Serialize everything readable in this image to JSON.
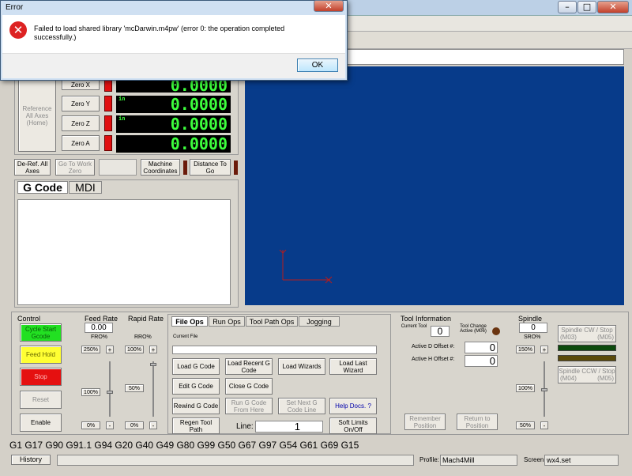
{
  "window": {
    "controls": [
      "–",
      "□",
      "✕"
    ]
  },
  "dro": {
    "ref_all": "Reference All Axes (Home)",
    "axes": [
      {
        "zero": "Zero X",
        "value": "0.0000"
      },
      {
        "zero": "Zero Y",
        "value": "0.0000",
        "unit": "in"
      },
      {
        "zero": "Zero Z",
        "value": "0.0000",
        "unit": "in"
      },
      {
        "zero": "Zero A",
        "value": "0.0000"
      }
    ],
    "deref": "De-Ref. All Axes",
    "goto_zero": "Go To Work Zero",
    "machine_coords": "Machine Coordinates",
    "dist_to_go": "Distance To Go"
  },
  "gcode_tabs": [
    "G Code",
    "MDI"
  ],
  "control": {
    "title": "Control",
    "cycle_start": "Cycle Start Gcode",
    "feed_hold": "Feed Hold",
    "stop": "Stop",
    "reset": "Reset",
    "enable": "Enable"
  },
  "feed": {
    "title": "Feed Rate",
    "value": "0.00",
    "label": "FRO%",
    "max": "250%",
    "mid": "100%",
    "min": "0%",
    "plus": "+",
    "minus": "-"
  },
  "rapid": {
    "title": "Rapid Rate",
    "label": "RRO%",
    "max": "100%",
    "mid": "50%",
    "min": "0%",
    "plus": "+",
    "minus": "-"
  },
  "fileops": {
    "tabs": [
      "File Ops",
      "Run Ops",
      "Tool Path Ops",
      "Jogging"
    ],
    "current_file": "Current File",
    "load": "Load G Code",
    "load_recent": "Load Recent G Code",
    "load_wizards": "Load Wizards",
    "load_last": "Load Last Wizard",
    "edit": "Edit G Code",
    "close": "Close G Code",
    "rewind": "Rewind G Code",
    "run_from_here": "Run G Code From Here",
    "set_next": "Set Next G Code Line",
    "help": "Help Docs. ?",
    "regen": "Regen Tool Path",
    "line_label": "Line:",
    "line_value": "1",
    "soft_limits": "Soft Limits On/Off"
  },
  "tool": {
    "title": "Tool Information",
    "current_label": "Current Tool",
    "current_value": "0",
    "change_label": "Tool Change Active (M06)",
    "d_label": "Active D Offset #:",
    "d_value": "0",
    "h_label": "Active H Offset #:",
    "h_value": "0",
    "remember": "Remember Position",
    "return": "Return to Position"
  },
  "spindle": {
    "title": "Spindle",
    "value": "0",
    "label": "SRO%",
    "max": "150%",
    "mid": "100%",
    "min": "50%",
    "plus": "+",
    "minus": "-",
    "cw": "Spindle CW / Stop",
    "m03": "(M03)",
    "m05a": "(M05)",
    "ccw": "Spindle CCW / Stop",
    "m04": "(M04)",
    "m05b": "(M05)"
  },
  "status": {
    "gcodes": "G1 G17 G90 G91.1 G94 G20 G40 G49 G80 G99 G50 G67 G97 G54 G61 G69 G15",
    "history": "History",
    "profile_label": "Profile:",
    "profile": "Mach4Mill",
    "screen_label": "Screen:",
    "screen": "wx4.set"
  },
  "error": {
    "title": "Error",
    "message": "Failed to load shared library 'mcDarwin.m4pw' (error 0: the operation completed successfully.)",
    "ok": "OK"
  },
  "colors": {
    "toolpath_bg": "#073b8a",
    "dro_text": "#3dff3d"
  }
}
